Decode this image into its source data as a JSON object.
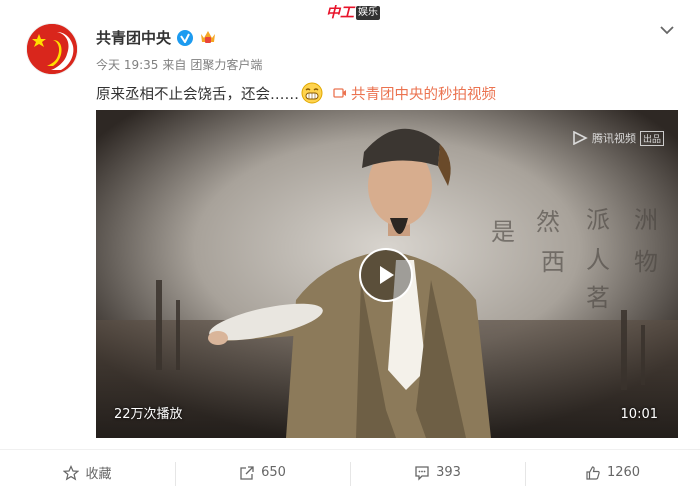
{
  "watermark": {
    "script": "中工",
    "box": "娱乐"
  },
  "post": {
    "author": "共青团中央",
    "time": "今天 19:35",
    "source_prefix": "来自",
    "source": "团聚力客户端",
    "text": "原来丞相不止会饶舌，还会……",
    "video_link": "共青团中央的秒拍视频"
  },
  "video": {
    "brand": "腾讯视频",
    "brand_tag": "出品",
    "bg_chars": [
      "是",
      "然",
      "派",
      "洲",
      "西",
      "人",
      "物",
      "茗"
    ],
    "views": "22万次播放",
    "duration": "10:01"
  },
  "actions": {
    "favorite_label": "收藏",
    "repost_count": "650",
    "comment_count": "393",
    "like_count": "1260"
  },
  "colors": {
    "accent": "#eb7350",
    "verified": "#1d9bf0",
    "watermark_red": "#e8132a"
  }
}
